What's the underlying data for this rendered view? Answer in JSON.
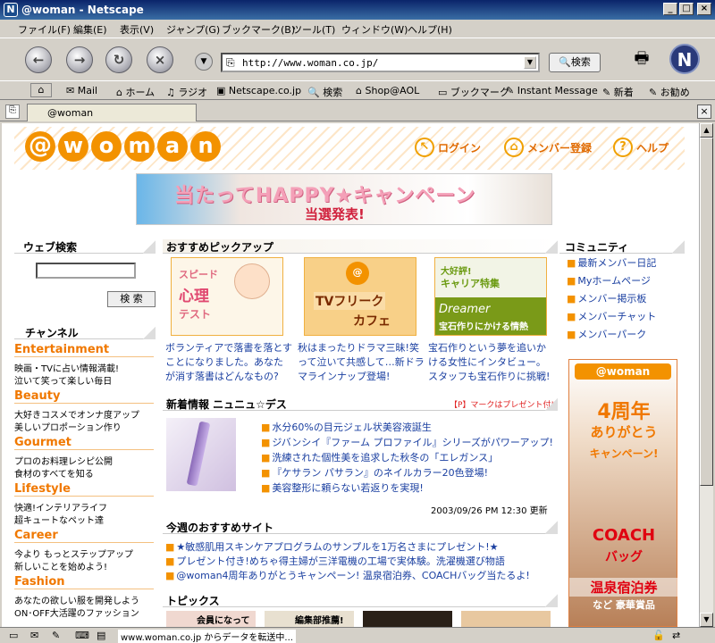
{
  "window": {
    "title": "@woman - Netscape"
  },
  "menu": [
    "ファイル(F)",
    "編集(E)",
    "表示(V)",
    "ジャンプ(G)",
    "ブックマーク(B)",
    "ツール(T)",
    "ウィンドウ(W)",
    "ヘルプ(H)"
  ],
  "nav": {
    "url": "http://www.woman.co.jp/",
    "search_label": "検索"
  },
  "personal": [
    "Mail",
    "ホーム",
    "ラジオ",
    "Netscape.co.jp",
    "検索",
    "Shop@AOL",
    "ブックマーク",
    "Instant Message",
    "新着",
    "お勧め"
  ],
  "tab": {
    "label": "@woman"
  },
  "status": {
    "text": "www.woman.co.jp からデータを転送中..."
  },
  "header": {
    "logo_letters": [
      "@",
      "w",
      "o",
      "m",
      "a",
      "n"
    ],
    "login": "ログイン",
    "member": "メンバー登録",
    "help": "ヘルプ"
  },
  "banner": {
    "line1": "当たってHAPPY★キャンペーン",
    "line2": "当選発表!"
  },
  "websearch": {
    "title": "ウェブ検索",
    "button": "検 索"
  },
  "channel": {
    "title": "チャンネル",
    "items": [
      {
        "name": "Entertainment",
        "l1": "映画・TVに占い情報満載!",
        "l2": "泣いて笑って楽しい毎日"
      },
      {
        "name": "Beauty",
        "l1": "大好きコスメでオンナ度アップ",
        "l2": "美しいプロポーション作り"
      },
      {
        "name": "Gourmet",
        "l1": "プロのお料理レシピ公開",
        "l2": "食材のすべてを知る"
      },
      {
        "name": "Lifestyle",
        "l1": "快適!インテリアライフ",
        "l2": "超キュートなペット達"
      },
      {
        "name": "Career",
        "l1": "今より もっとステップアップ",
        "l2": "新しいことを始めよう!"
      },
      {
        "name": "Fashion",
        "l1": "あなたの欲しい服を開発しよう",
        "l2": "ON･OFF大活躍のファッション"
      }
    ]
  },
  "pickup": {
    "title": "おすすめピックアップ",
    "items": [
      {
        "img1": "スピード",
        "img2": "心理",
        "img3": "テスト",
        "text": "ボランティアで落書を落とすことになりました。あなたが消す落書はどんなもの?"
      },
      {
        "img1": "@",
        "img2": "TVフリーク",
        "img3": "カフェ",
        "text": "秋はまったりドラマ三昧!笑って泣いて共感して…新ドラマラインナップ登場!"
      },
      {
        "img1": "大好評!",
        "img2": "キャリア特集",
        "img3": "宝石作りにかける情熱",
        "text": "宝石作りという夢を追いかける女性にインタビュー。スタッフも宝石作りに挑戦!"
      }
    ]
  },
  "news": {
    "title": "新着情報 ニュニュ☆デス",
    "note": "【P】マークはプレゼント付!",
    "items": [
      "水分60%の目元ジェル状美容液誕生",
      "ジバンシイ『ファーム プロファイル』シリーズがパワーアップ!",
      "洗練された個性美を追求した秋冬の「エレガンス」",
      "『ケサラン パサラン』のネイルカラー20色登場!",
      "美容整形に頼らない若返りを実現!"
    ],
    "updated": "2003/09/26 PM 12:30 更新"
  },
  "weekly": {
    "title": "今週のおすすめサイト",
    "items": [
      "★敏感肌用スキンケアプログラムのサンプルを1万名さまにプレゼント!★",
      "プレゼント付き!めちゃ得主婦が三洋電機の工場で実体験。洗濯機選び物語",
      "@woman4周年ありがとうキャンペーン! 温泉宿泊券、COACHバッグ当たるよ!"
    ]
  },
  "topics": {
    "title": "トピックス",
    "thumbs": [
      "会員になって",
      "編集部推薦!"
    ]
  },
  "community": {
    "title": "コミュニティ",
    "items": [
      "最新メンバー日記",
      "Myホームページ",
      "メンバー掲示板",
      "メンバーチャット",
      "メンバーパーク"
    ]
  },
  "ad": {
    "logo": "@woman",
    "line1": "4周年",
    "line2": "ありがとう",
    "line3": "キャンペーン!",
    "line4": "COACH",
    "line5": "バッグ",
    "line6": "温泉宿泊券",
    "line7": "など 豪華賞品"
  }
}
